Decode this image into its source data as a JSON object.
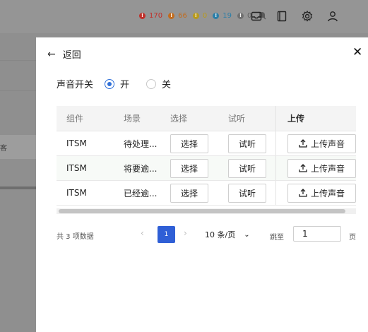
{
  "status": {
    "items": [
      {
        "icon": "error-icon",
        "count": "170",
        "color": "#c0302a"
      },
      {
        "icon": "warning-icon",
        "count": "66",
        "color": "#c26c1e"
      },
      {
        "icon": "minor-warning-icon",
        "count": "0",
        "color": "#b99a1a"
      },
      {
        "icon": "info-icon",
        "count": "19",
        "color": "#2a7ea8"
      },
      {
        "icon": "unknown-icon",
        "count": "0",
        "color": "#707070"
      }
    ]
  },
  "drawer": {
    "back_label": "返回",
    "close_label": "✕",
    "sound_switch_label": "声音开关",
    "on_label": "开",
    "off_label": "关",
    "sound_on": true
  },
  "table": {
    "headers": {
      "component": "组件",
      "scene": "场景",
      "select": "选择",
      "listen": "试听",
      "upload": "上传"
    },
    "rows": [
      {
        "component": "ITSM",
        "scene": "待处理...",
        "select": "选择",
        "listen": "试听",
        "upload": "上传声音"
      },
      {
        "component": "ITSM",
        "scene": "将要逾...",
        "select": "选择",
        "listen": "试听",
        "upload": "上传声音"
      },
      {
        "component": "ITSM",
        "scene": "已经逾...",
        "select": "选择",
        "listen": "试听",
        "upload": "上传声音"
      }
    ]
  },
  "pagination": {
    "total": "共 3 项数据",
    "current_page": "1",
    "page_size": "10 条/页",
    "goto_label": "跳至",
    "goto_value": "1",
    "goto_suffix": "页"
  },
  "background": {
    "side_item_fragment": "客"
  }
}
